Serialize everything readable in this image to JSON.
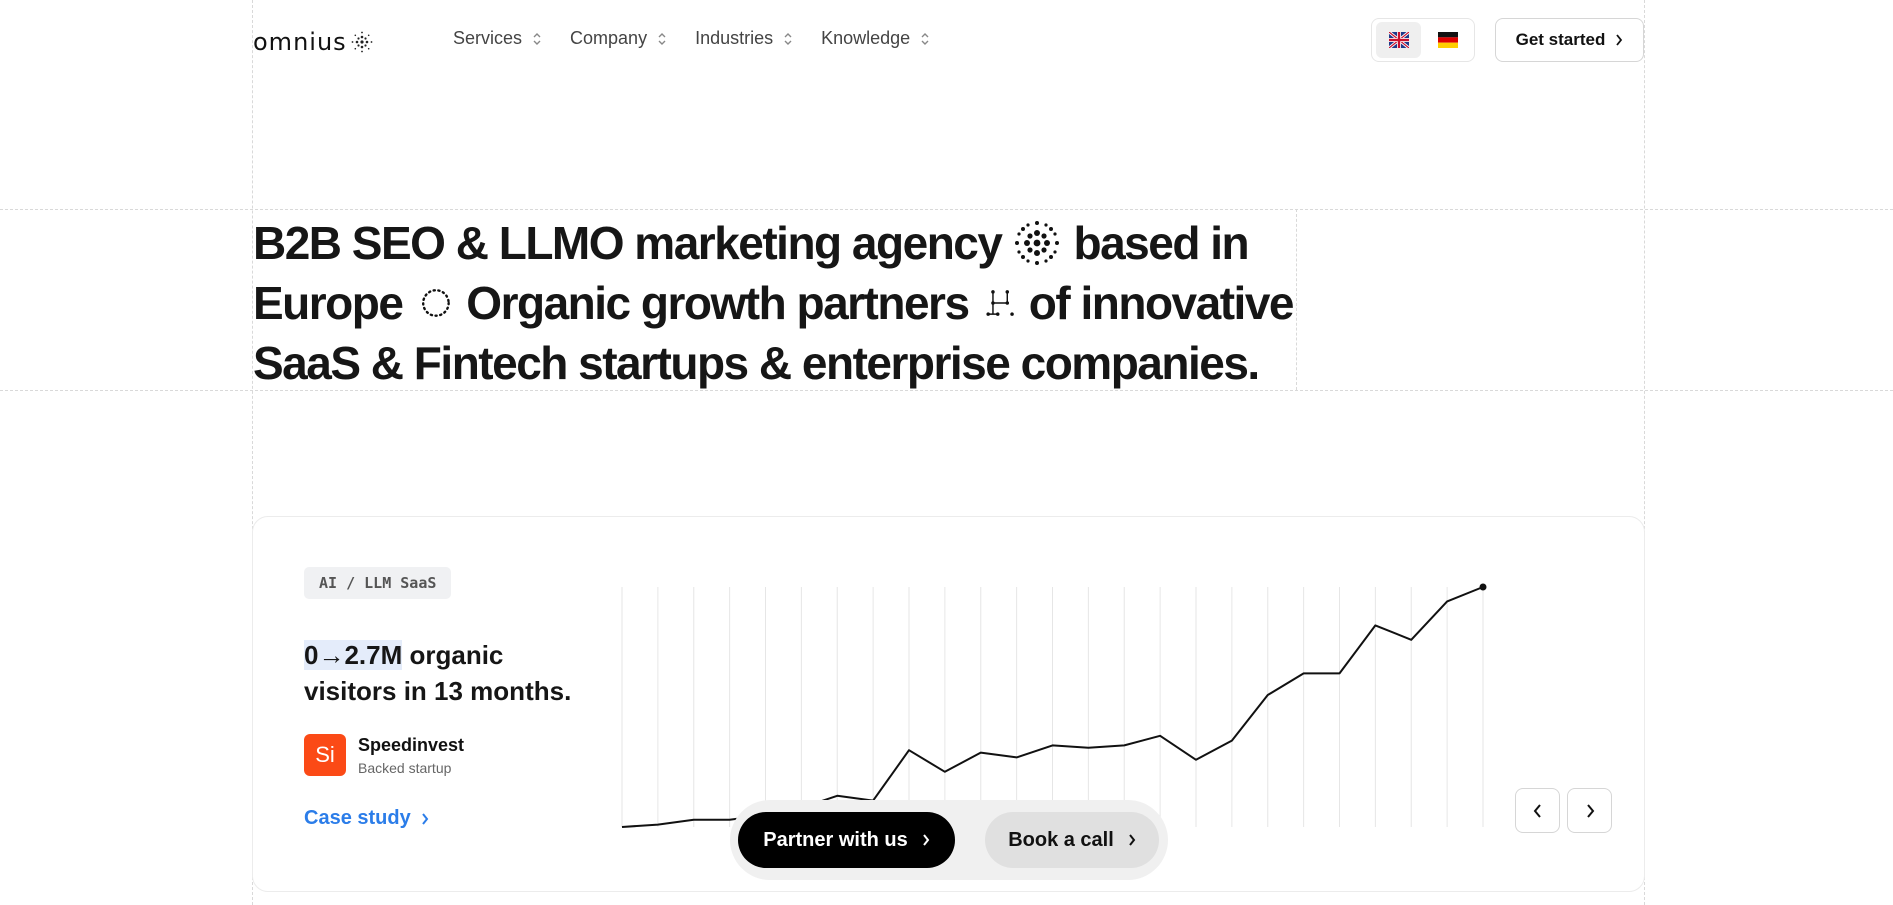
{
  "header": {
    "logo_text": "omnius",
    "nav": [
      {
        "label": "Services"
      },
      {
        "label": "Company"
      },
      {
        "label": "Industries"
      },
      {
        "label": "Knowledge"
      }
    ],
    "languages": [
      {
        "code": "en",
        "icon": "uk-flag-icon",
        "active": true
      },
      {
        "code": "de",
        "icon": "german-flag-icon",
        "active": false
      }
    ],
    "cta_label": "Get started"
  },
  "hero": {
    "line1_a": "B2B SEO & LLMO marketing agency",
    "line1_b": "based in",
    "line2_a": "Europe",
    "line2_b": "Organic growth partners",
    "line2_c": "of innovative",
    "line3": "SaaS & Fintech startups & enterprise companies."
  },
  "case": {
    "tag": "AI / LLM SaaS",
    "headline_highlight": "0→2.7M",
    "headline_rest": " organic visitors in 13 months.",
    "client_initials": "Si",
    "client_name": "Speedinvest",
    "client_sub": "Backed startup",
    "link_label": "Case study",
    "accent_color": "#2b7de9",
    "client_color": "#fb4a16"
  },
  "chart_data": {
    "type": "line",
    "title": "",
    "xlabel": "",
    "ylabel": "",
    "grid": "vertical",
    "legend": "none",
    "x": [
      0,
      1,
      2,
      3,
      4,
      5,
      6,
      7,
      8,
      9,
      10,
      11,
      12,
      13,
      14,
      15,
      16,
      17,
      18,
      19,
      20,
      21,
      22,
      23,
      24
    ],
    "ylim": [
      0,
      1
    ],
    "series": [
      {
        "values": [
          0.0,
          0.01,
          0.03,
          0.03,
          0.05,
          0.08,
          0.13,
          0.11,
          0.32,
          0.23,
          0.31,
          0.29,
          0.34,
          0.33,
          0.34,
          0.38,
          0.28,
          0.36,
          0.55,
          0.64,
          0.64,
          0.84,
          0.78,
          0.94,
          1.0
        ]
      }
    ]
  },
  "cta": {
    "primary_label": "Partner with us",
    "secondary_label": "Book a call"
  }
}
